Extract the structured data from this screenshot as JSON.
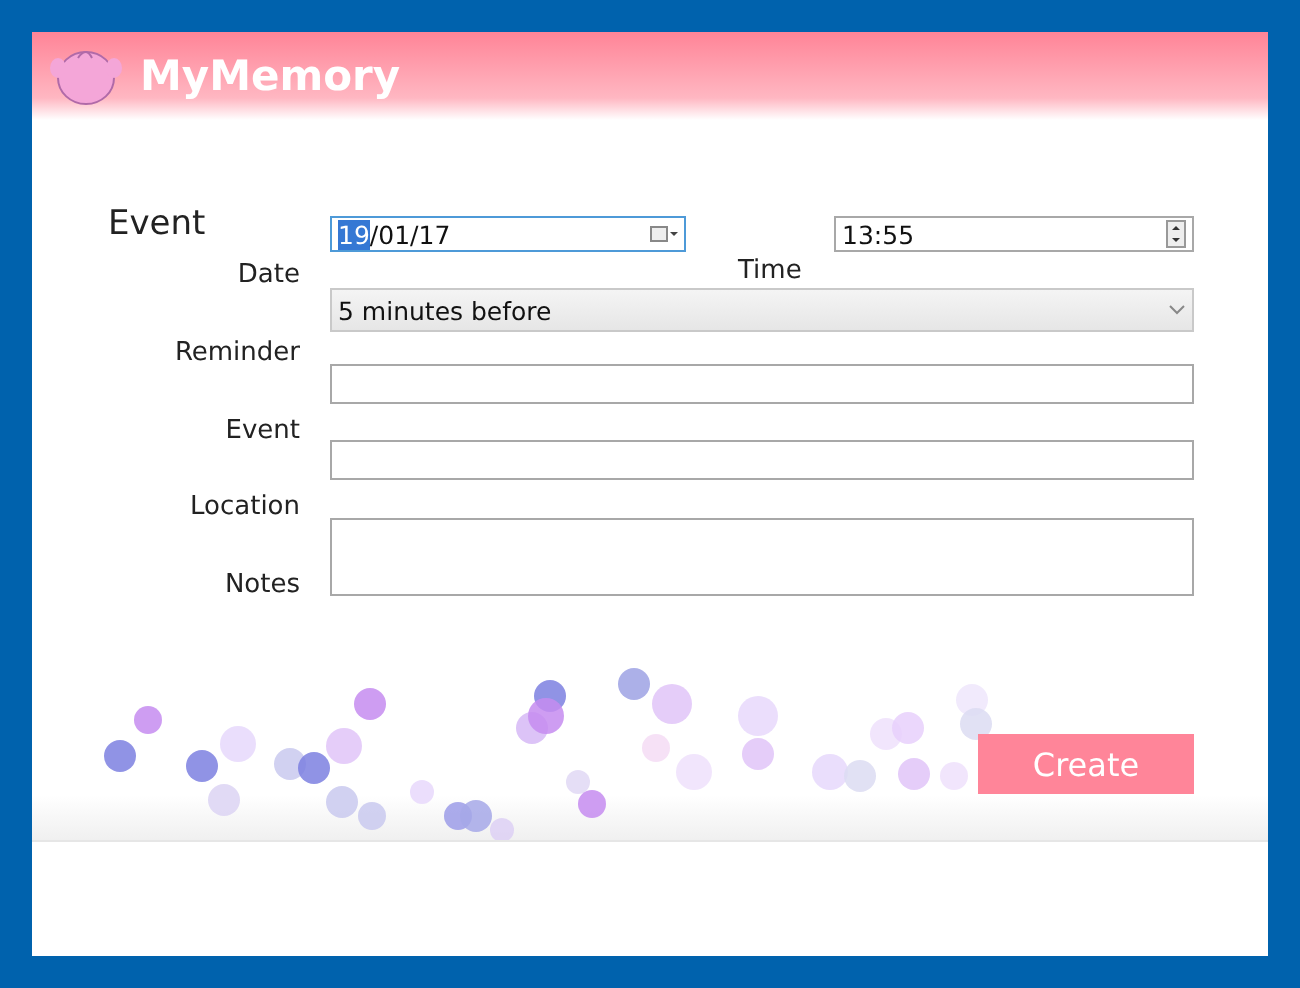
{
  "app": {
    "title": "MyMemory"
  },
  "heading": "Event",
  "labels": [
    "Date",
    "Time",
    "Reminder",
    "Event",
    "Location",
    "Notes"
  ],
  "date_field": {
    "selected_text": "19",
    "rest_text": "/01/17"
  },
  "time_field": {
    "value": "13:55"
  },
  "reminder_select": {
    "value": "5 minutes before"
  },
  "create_button": "Create"
}
